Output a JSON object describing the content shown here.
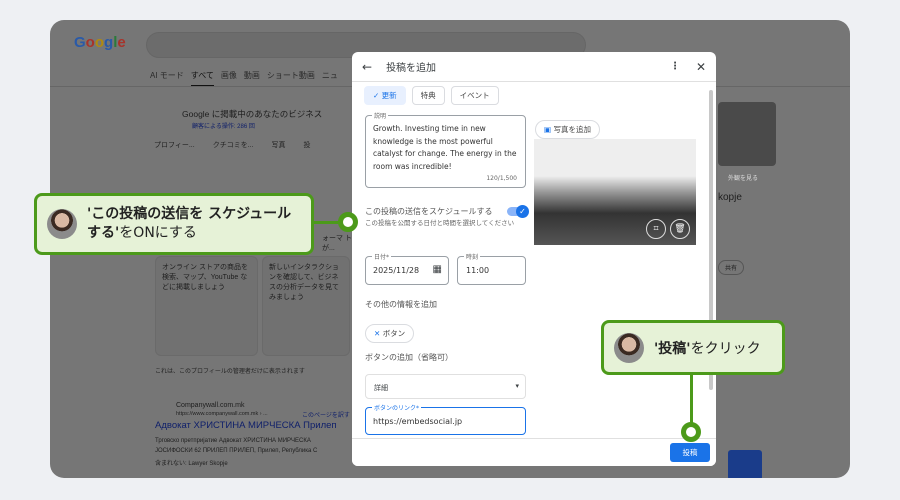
{
  "background": {
    "logo": "Google",
    "tabs": [
      "AI モード",
      "すべて",
      "画像",
      "動画",
      "ショート動画",
      "ニュ"
    ],
    "active_tab": "すべて",
    "business_title": "Google に掲載中のあなたのビジネス",
    "business_sub": "顧客による操作: 286 回",
    "actions": [
      "プロフィー...",
      "クチコミを...",
      "写真",
      "投"
    ],
    "card1_text": "オンライン ストアの商品を検索、マップ、YouTube などに掲載しましょう",
    "card2_text": "新しいインタラクションを確認して、ビジネスの分析データを見てみましょう",
    "card2_head": "ォーマ トが...",
    "admin_note": "これは、このプロフィールの管理者だけに表示されます",
    "result_site": "Companywall.com.mk",
    "result_url": "https://www.companywall.com.mk › ...",
    "translate": "このページを訳す",
    "result_title": "Адвокат ХРИСТИНА МИРЧЕСКА Прилеп",
    "result_snippet1": "Трговско претпријатие Адвокат ХРИСТИНА МИРЧЕСКА",
    "result_snippet2": "ЈОСИФОСКИ 62 ПРИЛЕП ПРИЛЕП, Прилеп, Република С",
    "result_missing": "含まれない: Lawyer Skopje",
    "side_view": "外観を見る",
    "side_name": "kopje",
    "side_share": "共有"
  },
  "dialog": {
    "title": "投稿を追加",
    "post_types": [
      "更新",
      "特典",
      "イベント"
    ],
    "selected_type": "更新",
    "description_label": "説明",
    "description": "Growth. Investing time in new knowledge is the most powerful catalyst for change. The energy in the room was incredible!",
    "char_count": "120/1,500",
    "add_photo": "写真を追加",
    "schedule_title": "この投稿の送信をスケジュールする",
    "schedule_sub": "この投稿を公開する日付と時間を選択してください",
    "schedule_on": true,
    "date_label": "日付*",
    "date": "2025/11/28",
    "time_label": "時刻",
    "time": "11:00",
    "more_info": "その他の情報を追加",
    "button_chip": "ボタン",
    "button_section": "ボタンの追加（省略可）",
    "button_type": "詳細",
    "link_label": "ボタンのリンク*",
    "link": "https://embedsocial.jp",
    "post_button": "投稿"
  },
  "callouts": {
    "schedule_bold": "'この投稿の送信を スケジュールする'",
    "schedule_rest": "をONにする",
    "post_bold": "'投稿'",
    "post_rest": "をクリック"
  },
  "colors": {
    "accent": "#1a73e8",
    "callout_border": "#4c9a1a",
    "callout_bg": "#e6f2d7"
  }
}
